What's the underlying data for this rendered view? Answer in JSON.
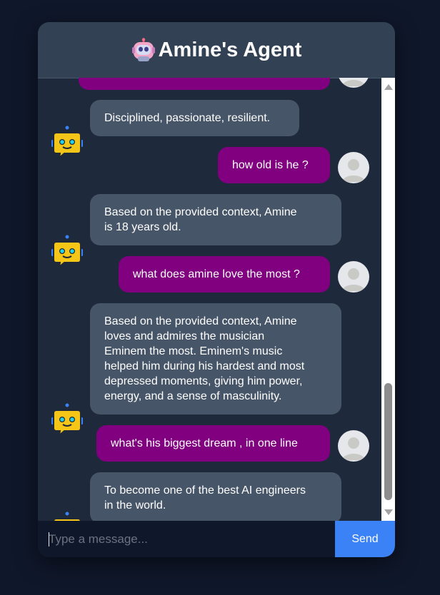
{
  "header": {
    "title": "Amine's Agent",
    "icon": "robot-icon"
  },
  "messages": [
    {
      "sender": "bot",
      "text": "Disciplined, passionate, resilient."
    },
    {
      "sender": "user",
      "text": "how old is he ?"
    },
    {
      "sender": "bot",
      "text": "Based on the provided context, Amine\nis 18 years old."
    },
    {
      "sender": "user",
      "text": "what does amine love the most ?"
    },
    {
      "sender": "bot",
      "text": "Based on the provided context, Amine\nloves and admires the musician\nEminem the most. Eminem's music\nhelped him during his hardest and most\ndepressed moments, giving him power,\nenergy, and a sense of masculinity."
    },
    {
      "sender": "user",
      "text": "what's his biggest dream , in one line"
    },
    {
      "sender": "bot",
      "text": "To become one of the best AI engineers\nin the world."
    }
  ],
  "input": {
    "placeholder": "Type a message...",
    "value": ""
  },
  "send_button": {
    "label": "Send"
  },
  "colors": {
    "background": "#0f172a",
    "panel": "#1e293b",
    "header": "#334155",
    "bot_bubble": "#475569",
    "user_bubble": "#800080",
    "send_button": "#3b82f6"
  }
}
